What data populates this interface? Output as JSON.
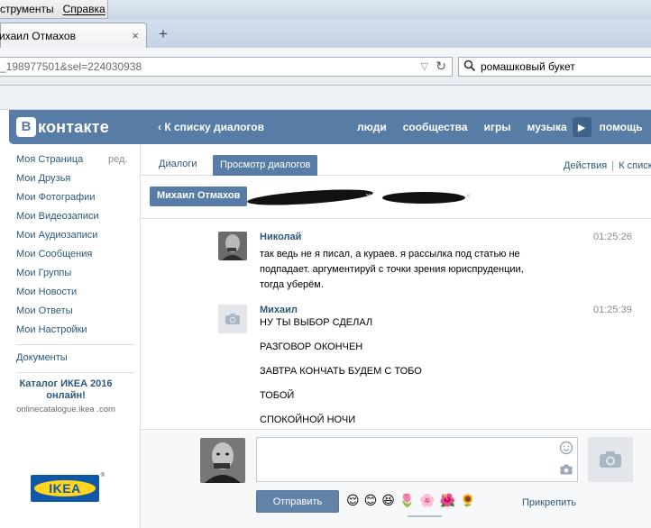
{
  "browser": {
    "menu_items": [
      "струменты",
      "Справка"
    ],
    "tab_title": "ихаил Отмахов",
    "tab_close": "×",
    "new_tab": "+",
    "url": "_198977501&sel=224030938",
    "search_value": "ромашковый букет"
  },
  "vk": {
    "logo_box": "В",
    "logo_text": "контакте",
    "back_link": "‹  К списку диалогов",
    "nav": [
      "люди",
      "сообщества",
      "игры",
      "музыка",
      "помощь"
    ],
    "nav_arrow": "▶",
    "accent_color": "#577ca5"
  },
  "sidebar": {
    "items": [
      "Моя Страница",
      "Мои Друзья",
      "Мои Фотографии",
      "Мои Видеозаписи",
      "Мои Аудиозаписи",
      "Мои Сообщения",
      "Мои Группы",
      "Мои Новости",
      "Мои Ответы",
      "Мои Настройки"
    ],
    "edit_link": "ред.",
    "docs": "Документы",
    "ad_title": "Каталог ИКЕА 2016 онлайн!",
    "ad_domain": "onlinecatalogue.ikea .com",
    "ikea_logo_text": "IKEA",
    "ikea_reg": "®"
  },
  "dialogs": {
    "tab_dialogs": "Диалоги",
    "tab_view": "Просмотр диалогов",
    "actions": "Действия",
    "to_list": "К списк",
    "separator": "|",
    "chip_name": "Михаил Отмахов",
    "chip_close": "×"
  },
  "messages": [
    {
      "author": "Николай",
      "time": "01:25:26",
      "lines": [
        "так ведь не я писал, а кураев. я рассылка под статью не подпадает. аргументируй с точки зрения юриспруденции, тогда уберём."
      ]
    },
    {
      "author": "Михаил",
      "time": "01:25:39",
      "lines": [
        "НУ ТЫ ВЫБОР СДЕЛАЛ",
        "РАЗГОВОР ОКОНЧЕН",
        "ЗАВТРА КОНЧАТЬ БУДЕМ С ТОБО",
        "ТОБОЙ",
        "СПОКОЙНОЙ НОЧИ"
      ]
    }
  ],
  "compose": {
    "send_label": "Отправить",
    "attach_label": "Прикрепить",
    "emojis": [
      "😌",
      "😊",
      "😆",
      "🌷",
      "🌸",
      "🌺",
      "🌻"
    ]
  }
}
